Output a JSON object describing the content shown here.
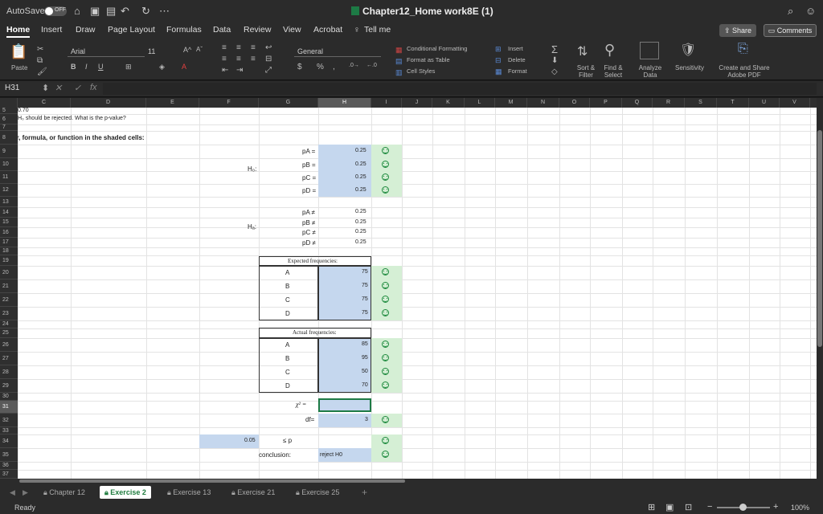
{
  "titlebar": {
    "autosave_label": "AutoSave",
    "autosave_state": "OFF",
    "doc_title": "Chapter12_Home work8E (1)"
  },
  "tabs": [
    "Home",
    "Insert",
    "Draw",
    "Page Layout",
    "Formulas",
    "Data",
    "Review",
    "View",
    "Acrobat"
  ],
  "tell_me": "Tell me",
  "share_label": "Share",
  "comments_label": "Comments",
  "ribbon": {
    "paste": "Paste",
    "font_name": "Arial",
    "font_size": "11",
    "number_format": "General",
    "conditional_formatting": "Conditional Formatting",
    "format_as_table": "Format as Table",
    "cell_styles": "Cell Styles",
    "insert": "Insert",
    "delete": "Delete",
    "format": "Format",
    "sort_filter": "Sort & Filter",
    "find_select": "Find & Select",
    "analyze_data": "Analyze Data",
    "sensitivity": "Sensitivity",
    "create_share_pdf": "Create and Share Adobe PDF"
  },
  "namebox": "H31",
  "columns": [
    "C",
    "D",
    "E",
    "F",
    "G",
    "H",
    "I",
    "J",
    "K",
    "L",
    "M",
    "N",
    "O",
    "P",
    "Q",
    "R",
    "S",
    "T",
    "U",
    "V"
  ],
  "rows": [
    "5",
    "6",
    "7",
    "8",
    "9",
    "10",
    "11",
    "12",
    "13",
    "14",
    "15",
    "16",
    "17",
    "18",
    "19",
    "20",
    "21",
    "22",
    "23",
    "24",
    "25",
    "26",
    "27",
    "28",
    "29",
    "30",
    "31",
    "32",
    "33",
    "34",
    "35",
    "36",
    "37"
  ],
  "sheet": {
    "r5": "0.70",
    "r6": "H₀ should be rejected. What is the p-value?",
    "r8": "er, formula, or function in the shaded cells:",
    "h0_label": "H₀:",
    "ha_label": "Hₐ:",
    "h0_params": [
      "pA =",
      "pB =",
      "pC =",
      "pD ="
    ],
    "h0_values": [
      "0.25",
      "0.25",
      "0.25",
      "0.25"
    ],
    "ha_params": [
      "pA ≠",
      "pB ≠",
      "pC ≠",
      "pD ≠"
    ],
    "ha_values": [
      "0.25",
      "0.25",
      "0.25",
      "0.25"
    ],
    "expected_title": "Expected frequencies:",
    "expected_cats": [
      "A",
      "B",
      "C",
      "D"
    ],
    "expected_vals": [
      "75",
      "75",
      "75",
      "75"
    ],
    "actual_title": "Actual frequencies:",
    "actual_cats": [
      "A",
      "B",
      "C",
      "D"
    ],
    "actual_vals": [
      "85",
      "95",
      "50",
      "70"
    ],
    "chi_label": "χ² =",
    "df_label": "df=",
    "df_value": "3",
    "alpha": "0.05",
    "le_p": "≤ p",
    "conclusion_label": "conclusion:",
    "conclusion_value": "reject H0"
  },
  "sheet_tabs": [
    "Chapter 12",
    "Exercise 2",
    "Exercise 13",
    "Exercise 21",
    "Exercise 25"
  ],
  "active_sheet": "Exercise 2",
  "status": "Ready",
  "zoom": "100%"
}
